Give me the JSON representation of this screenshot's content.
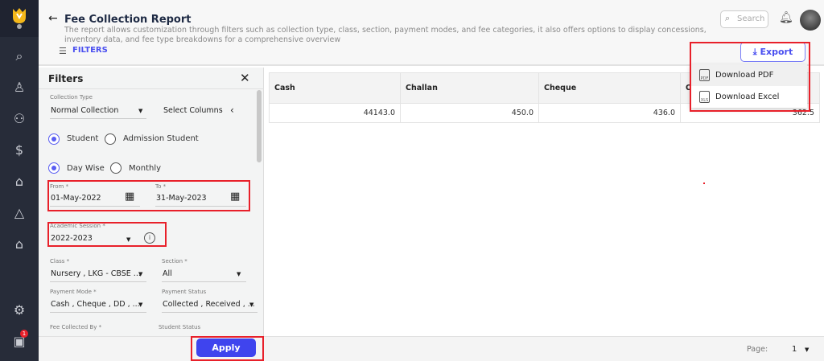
{
  "header": {
    "title": "Fee Collection Report",
    "description": "The report allows customization through filters such as collection type, class, section, payment modes, and fee categories, it also offers options to display concessions, inventory data, and fee type breakdowns for a comprehensive overview",
    "filters_link": "FILTERS",
    "search_placeholder": "Search",
    "export_label": "Export"
  },
  "export_menu": [
    "Download PDF",
    "Download Excel"
  ],
  "sidebar": {
    "icons": [
      "search-icon",
      "student-icon",
      "users-icon",
      "dollar-icon",
      "building-icon",
      "network-icon",
      "graduation-icon",
      "settings-icon",
      "chat-icon"
    ],
    "notification_badge": "1"
  },
  "filters": {
    "title": "Filters",
    "collection_type_label": "Collection Type",
    "collection_type": "Normal Collection",
    "select_columns": "Select Columns",
    "student_options": [
      "Student",
      "Admission Student"
    ],
    "period_options": [
      "Day Wise",
      "Monthly"
    ],
    "from_label": "From *",
    "from": "01-May-2022",
    "to_label": "To *",
    "to": "31-May-2023",
    "session_label": "Academic Session *",
    "session": "2022-2023",
    "class_label": "Class *",
    "class": "Nursery , LKG - CBSE ...",
    "section_label": "Section *",
    "section": "All",
    "payment_mode_label": "Payment Mode *",
    "payment_mode": "Cash , Cheque , DD , ...",
    "payment_status_label": "Payment Status",
    "payment_status": "Collected , Received , ...",
    "fee_collected_by_label": "Fee Collected By *",
    "student_status_label": "Student Status",
    "apply": "Apply"
  },
  "table": {
    "columns": [
      "Cash",
      "Challan",
      "Cheque",
      "O"
    ],
    "rows": [
      [
        "44143.0",
        "450.0",
        "436.0",
        "362.5"
      ]
    ]
  },
  "pagination": {
    "label": "Page:",
    "value": "1"
  },
  "colors": {
    "accent": "#3f44ee",
    "sidebar": "#272c39",
    "highlight": "#e8202a"
  }
}
